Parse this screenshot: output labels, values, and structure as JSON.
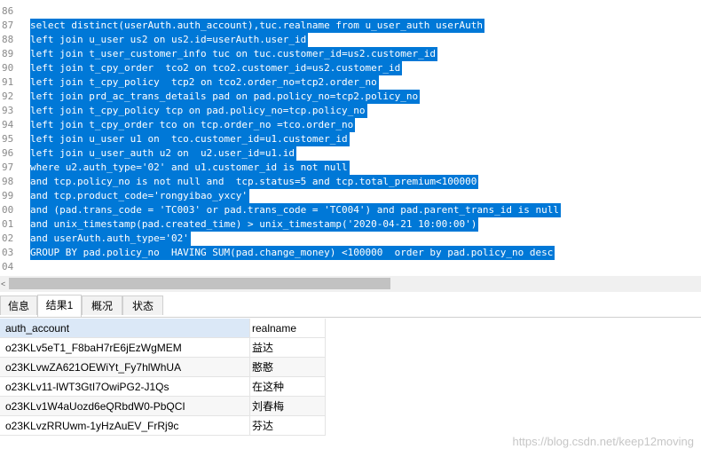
{
  "editor": {
    "lines": [
      {
        "num": "86",
        "text": ""
      },
      {
        "num": "87",
        "text": "select distinct(userAuth.auth_account),tuc.realname from u_user_auth userAuth"
      },
      {
        "num": "88",
        "text": "left join u_user us2 on us2.id=userAuth.user_id"
      },
      {
        "num": "89",
        "text": "left join t_user_customer_info tuc on tuc.customer_id=us2.customer_id"
      },
      {
        "num": "90",
        "text": "left join t_cpy_order  tco2 on tco2.customer_id=us2.customer_id"
      },
      {
        "num": "91",
        "text": "left join t_cpy_policy  tcp2 on tco2.order_no=tcp2.order_no"
      },
      {
        "num": "92",
        "text": "left join prd_ac_trans_details pad on pad.policy_no=tcp2.policy_no"
      },
      {
        "num": "93",
        "text": "left join t_cpy_policy tcp on pad.policy_no=tcp.policy_no"
      },
      {
        "num": "94",
        "text": "left join t_cpy_order tco on tcp.order_no =tco.order_no"
      },
      {
        "num": "95",
        "text": "left join u_user u1 on  tco.customer_id=u1.customer_id"
      },
      {
        "num": "96",
        "text": "left join u_user_auth u2 on  u2.user_id=u1.id"
      },
      {
        "num": "97",
        "text": "where u2.auth_type='02' and u1.customer_id is not null"
      },
      {
        "num": "98",
        "text": "and tcp.policy_no is not null and  tcp.status=5 and tcp.total_premium<100000"
      },
      {
        "num": "99",
        "text": "and tcp.product_code='rongyibao_yxcy'"
      },
      {
        "num": "00",
        "text": "and (pad.trans_code = 'TC003' or pad.trans_code = 'TC004') and pad.parent_trans_id is null"
      },
      {
        "num": "01",
        "text": "and unix_timestamp(pad.created_time) > unix_timestamp('2020-04-21 10:00:00')"
      },
      {
        "num": "02",
        "text": "and userAuth.auth_type='02'"
      },
      {
        "num": "03",
        "text": "GROUP BY pad.policy_no  HAVING SUM(pad.change_money) <100000  order by pad.policy_no desc"
      },
      {
        "num": "04",
        "text": ""
      }
    ]
  },
  "scrollbar": {
    "left_arrow": "<"
  },
  "tabs": [
    {
      "label": "信息"
    },
    {
      "label": "结果1"
    },
    {
      "label": "概况"
    },
    {
      "label": "状态"
    }
  ],
  "results": {
    "columns": [
      "auth_account",
      "realname"
    ],
    "rows": [
      [
        "o23KLv5eT1_F8baH7rE6jEzWgMEM",
        "益达"
      ],
      [
        "o23KLvwZA621OEWiYt_Fy7hlWhUA",
        "憨憨"
      ],
      [
        "o23KLv11-lWT3GtI7OwiPG2-J1Qs",
        "在这种"
      ],
      [
        "o23KLv1W4aUozd6eQRbdW0-PbQCI",
        "刘春梅"
      ],
      [
        "o23KLvzRRUwm-1yHzAuEV_FrRj9c",
        "芬达"
      ]
    ]
  },
  "watermark": "https://blog.csdn.net/keep12moving"
}
